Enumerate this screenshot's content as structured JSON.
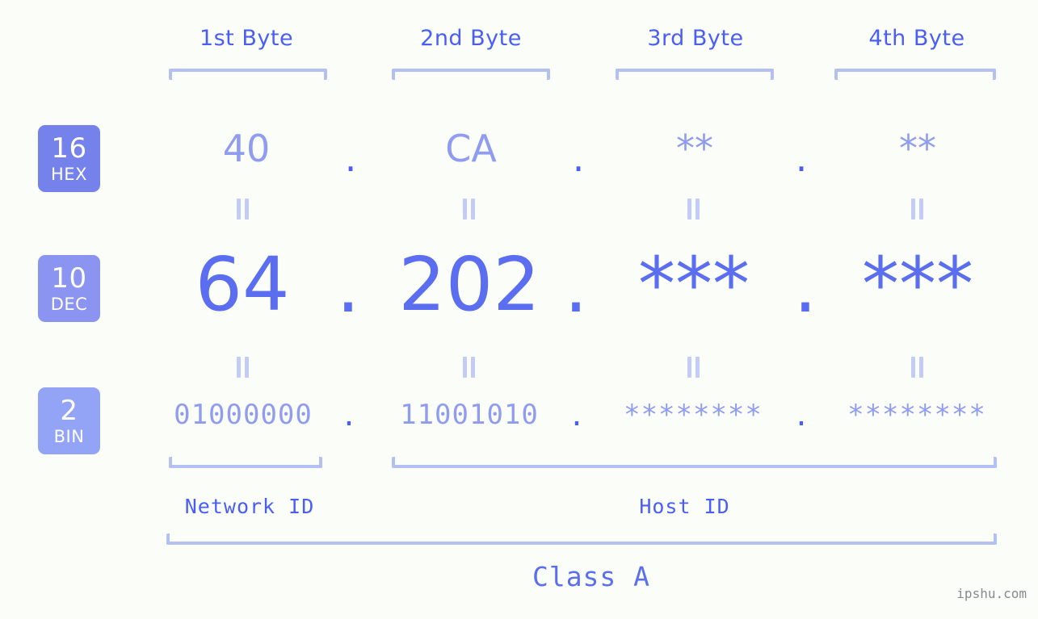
{
  "page": {
    "background_color": "#fbfdf9",
    "accent_color": "#5b6ef0",
    "muted_accent_color": "#8f9cf0",
    "bracket_color": "#b5c0f2",
    "watermark": "ipshu.com"
  },
  "headers": [
    {
      "label": "1st Byte"
    },
    {
      "label": "2nd Byte"
    },
    {
      "label": "3rd Byte"
    },
    {
      "label": "4th Byte"
    }
  ],
  "radix_badges": [
    {
      "radix": "16",
      "name": "HEX",
      "color": "#7582ec"
    },
    {
      "radix": "10",
      "name": "DEC",
      "color": "#8b94f0"
    },
    {
      "radix": "2",
      "name": "BIN",
      "color": "#93a3f5"
    }
  ],
  "rows": {
    "hex": {
      "radix": "16",
      "name": "HEX",
      "values": [
        "40",
        "CA",
        "**",
        "**"
      ],
      "separator": "."
    },
    "dec": {
      "radix": "10",
      "name": "DEC",
      "values": [
        "64",
        "202",
        "***",
        "***"
      ],
      "separator": "."
    },
    "bin": {
      "radix": "2",
      "name": "BIN",
      "values": [
        "01000000",
        "11001010",
        "********",
        "********"
      ],
      "separator": "."
    }
  },
  "equal_marks": {
    "symbol": "||",
    "count_per_gap": 4
  },
  "segments": {
    "network_id": {
      "label": "Network ID"
    },
    "host_id": {
      "label": "Host ID"
    },
    "address_class": {
      "label": "Class A"
    }
  }
}
